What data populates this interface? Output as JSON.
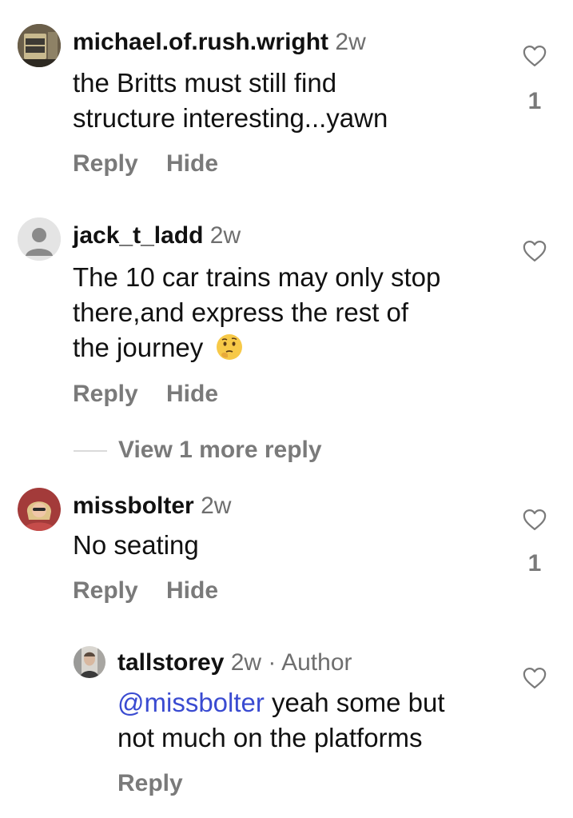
{
  "comments": [
    {
      "username": "michael.of.rush.wright",
      "time": "2w",
      "lines": [
        "the Britts must still find",
        "structure interesting...yawn"
      ],
      "reply_label": "Reply",
      "hide_label": "Hide",
      "likes": "1",
      "avatar_icon": "custom-photo"
    },
    {
      "username": "jack_t_ladd",
      "time": "2w",
      "lines": [
        "The 10 car trains may only stop",
        "there,and express the rest of",
        "the journey"
      ],
      "emoji_icon": "thinking-face-emoji",
      "reply_label": "Reply",
      "hide_label": "Hide",
      "avatar_icon": "default-person",
      "view_more_label": "View 1 more reply"
    },
    {
      "username": "missbolter",
      "time": "2w",
      "lines": [
        "No seating"
      ],
      "reply_label": "Reply",
      "hide_label": "Hide",
      "likes": "1",
      "avatar_icon": "custom-photo"
    }
  ],
  "reply": {
    "username": "tallstorey",
    "time": "2w",
    "separator": " · ",
    "author_tag": "Author",
    "mention": "@missbolter",
    "line1_rest": " yeah some but",
    "line2": "not much on the platforms",
    "reply_label": "Reply",
    "avatar_icon": "custom-photo"
  },
  "colors": {
    "text": "#111111",
    "muted": "#7a7a7a",
    "mention": "#3a4bd1",
    "background": "#ffffff"
  }
}
